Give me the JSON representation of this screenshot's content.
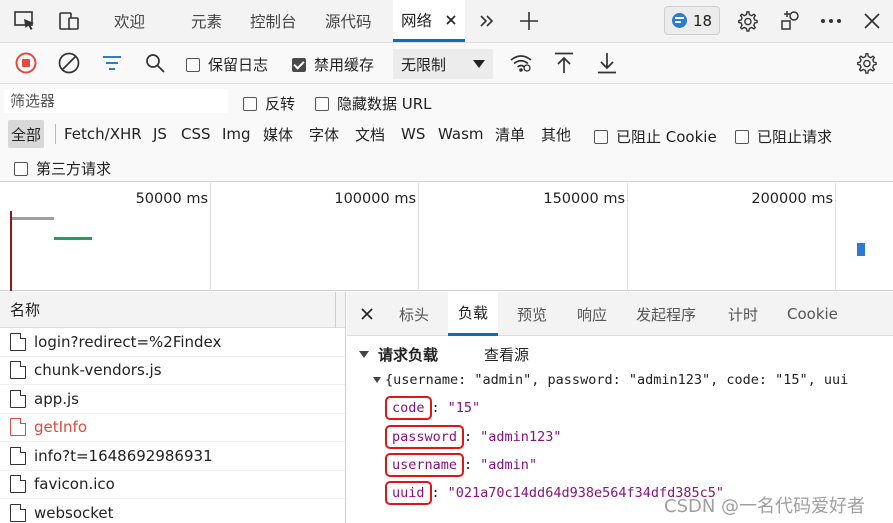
{
  "tabbar": {
    "tabs": [
      {
        "label": "欢迎"
      },
      {
        "label": "元素"
      },
      {
        "label": "控制台"
      },
      {
        "label": "源代码"
      },
      {
        "label": "网络"
      }
    ],
    "issues_count": "18"
  },
  "toolbar": {
    "preserve_log_label": "保留日志",
    "preserve_log_checked": false,
    "disable_cache_label": "禁用缓存",
    "disable_cache_checked": true,
    "throttle_value": "无限制"
  },
  "filter": {
    "placeholder": "筛选器",
    "invert_label": "反转",
    "hide_data_urls_label": "隐藏数据 URL",
    "types": [
      "全部",
      "Fetch/XHR",
      "JS",
      "CSS",
      "Img",
      "媒体",
      "字体",
      "文档",
      "WS",
      "Wasm",
      "清单",
      "其他"
    ],
    "active_type": "全部",
    "blocked_cookies_label": "已阻止 Cookie",
    "blocked_requests_label": "已阻止请求",
    "third_party_label": "第三方请求"
  },
  "timeline": {
    "ticks": [
      "50000 ms",
      "100000 ms",
      "150000 ms",
      "200000 ms"
    ]
  },
  "requests": {
    "header": "名称",
    "items": [
      {
        "name": "login?redirect=%2Findex",
        "error": false
      },
      {
        "name": "chunk-vendors.js",
        "error": false
      },
      {
        "name": "app.js",
        "error": false
      },
      {
        "name": "getInfo",
        "error": true
      },
      {
        "name": "info?t=1648692986931",
        "error": false
      },
      {
        "name": "favicon.ico",
        "error": false
      },
      {
        "name": "websocket",
        "error": false
      }
    ]
  },
  "detail": {
    "tabs": [
      "标头",
      "负载",
      "预览",
      "响应",
      "发起程序",
      "计时",
      "Cookie"
    ],
    "active_tab": "负载",
    "section_title": "请求负载",
    "view_source": "查看源",
    "object_summary": "{username: \"admin\", password: \"admin123\", code: \"15\", uui",
    "fields": [
      {
        "key": "code",
        "value": "\"15\""
      },
      {
        "key": "password",
        "value": "\"admin123\""
      },
      {
        "key": "username",
        "value": "\"admin\""
      },
      {
        "key": "uuid",
        "value": "\"021a70c14dd64d938e564f34dfd385c5\""
      }
    ]
  },
  "watermark": "CSDN @一名代码爱好者",
  "colors": {
    "accent": "#0f6cbd",
    "record_red": "#e5483e",
    "highlight_box": "#e01515",
    "key_purple": "#881280"
  }
}
